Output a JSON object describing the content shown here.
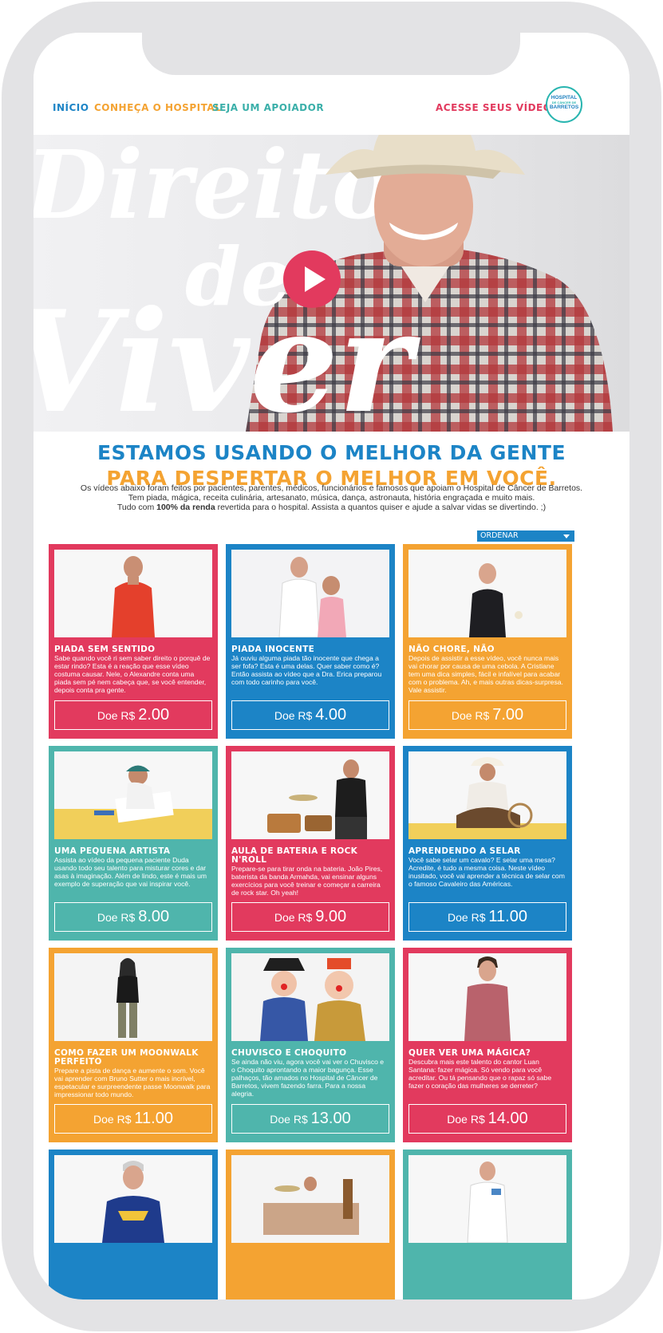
{
  "nav": {
    "inicio": "INÍCIO",
    "conheca": "CONHEÇA O HOSPITAL",
    "apoiador": "SEJA UM APOIADOR",
    "videos": "ACESSE SEUS VÍDEOS"
  },
  "logo": {
    "line1": "HOSPITAL",
    "line2": "DE CÂNCER DE",
    "line3": "BARRETOS"
  },
  "hero": {
    "word1": "Direito",
    "word2": "de",
    "word3": "Viver"
  },
  "headline": {
    "line1": "ESTAMOS USANDO O MELHOR DA GENTE",
    "line2": "PARA DESPERTAR O MELHOR EM VOCÊ."
  },
  "intro": {
    "p1": "Os vídeos abaixo foram feitos por pacientes, parentes, médicos, funcionários e famosos que apoiam o Hospital de Câncer de Barretos.",
    "p2": "Tem piada, mágica, receita culinária, artesanato, música, dança, astronauta, história engraçada e muito mais.",
    "p3a": "Tudo com ",
    "p3b": "100% da renda",
    "p3c": " revertida para o hospital. Assista a quantos quiser e ajude a salvar vidas se divertindo. ;)"
  },
  "sort": {
    "label": "ORDENAR"
  },
  "donate_prefix": "Doe R$",
  "cards": [
    {
      "title": "PIADA SEM SENTIDO",
      "desc": "Sabe quando você ri sem saber direito o porquê de estar rindo? Esta é a reação que esse vídeo costuma causar. Nele, o Alexandre conta uma piada sem pé nem cabeça que, se você entender, depois conta pra gente.",
      "amount": "2.00",
      "color": "#e23a5e"
    },
    {
      "title": "PIADA INOCENTE",
      "desc": "Já ouviu alguma piada tão inocente que chega a ser fofa? Esta é uma delas. Quer saber como é? Então assista ao vídeo que a Dra. Erica preparou com todo carinho para você.",
      "amount": "4.00",
      "color": "#1c84c6"
    },
    {
      "title": "NÃO CHORE, NÃO",
      "desc": "Depois de assistir a esse vídeo, você nunca mais vai chorar por causa de uma cebola. A Cristiane tem uma dica simples, fácil e infalível para acabar com o problema. Ah, e mais outras dicas-surpresa. Vale assistir.",
      "amount": "7.00",
      "color": "#f4a332"
    },
    {
      "title": "UMA PEQUENA ARTISTA",
      "desc": "Assista ao vídeo da pequena paciente Duda usando todo seu talento para misturar cores e dar asas à imaginação. Além de lindo, este é mais um exemplo de superação que vai inspirar você.",
      "amount": "8.00",
      "color": "#4fb5ac"
    },
    {
      "title": "AULA DE BATERIA E ROCK N'ROLL",
      "desc": "Prepare-se para tirar onda na bateria. João Pires, baterista da banda Armahda, vai ensinar alguns exercícios para você treinar e começar a carreira de rock star. Oh yeah!",
      "amount": "9.00",
      "color": "#e23a5e"
    },
    {
      "title": "APRENDENDO A SELAR",
      "desc": "Você sabe selar um cavalo? E selar uma mesa? Acredite, é tudo a mesma coisa. Neste vídeo inusitado, você vai aprender a técnica de selar com o famoso Cavaleiro das Américas.",
      "amount": "11.00",
      "color": "#1c84c6"
    },
    {
      "title": "COMO FAZER UM MOONWALK PERFEITO",
      "desc": "Prepare a pista de dança e aumente o som. Você vai aprender com Bruno Sutter o mais incrível, espetacular e surpreendente passe Moonwalk para impressionar todo mundo.",
      "amount": "11.00",
      "color": "#f4a332"
    },
    {
      "title": "CHUVISCO E CHOQUITO",
      "desc": "Se ainda não viu, agora você vai ver o Chuvisco e o Choquito aprontando a maior bagunça. Esse palhaços, tão amados no Hospital de Câncer de Barretos, vivem fazendo farra. Para a nossa alegria.",
      "amount": "13.00",
      "color": "#4fb5ac"
    },
    {
      "title": "QUER VER UMA MÁGICA?",
      "desc": "Descubra mais este talento do cantor Luan Santana: fazer mágica. Só vendo para você acreditar. Ou tá pensando que o rapaz só sabe fazer o coração das mulheres se derreter?",
      "amount": "14.00",
      "color": "#e23a5e"
    },
    {
      "title": "",
      "desc": "",
      "amount": "",
      "color": "#1c84c6"
    },
    {
      "title": "",
      "desc": "",
      "amount": "",
      "color": "#f4a332"
    },
    {
      "title": "",
      "desc": "",
      "amount": "",
      "color": "#4fb5ac"
    }
  ]
}
